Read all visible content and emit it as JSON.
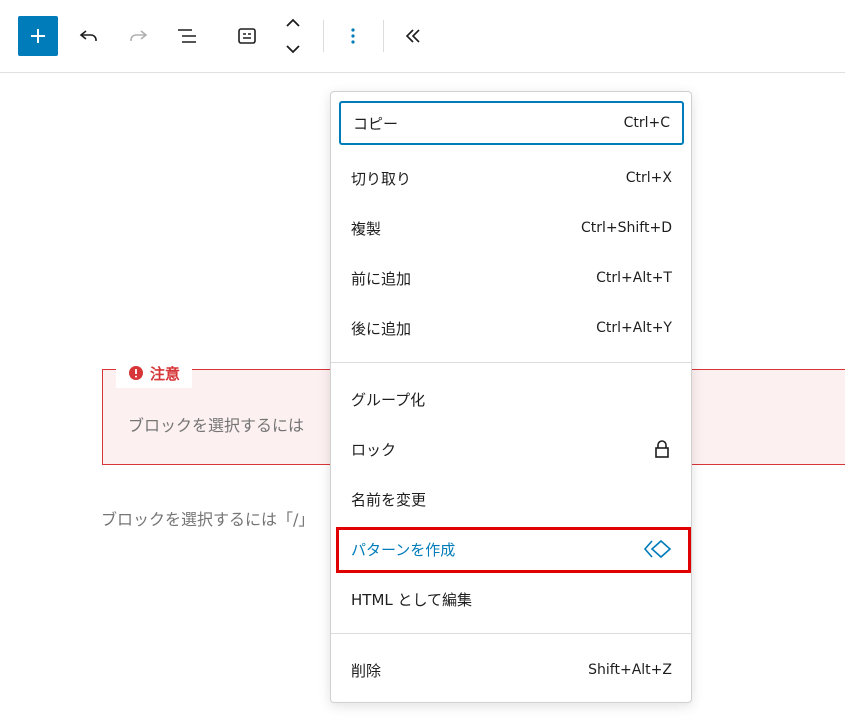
{
  "toolbar": {
    "add_icon": "plus-icon",
    "undo_icon": "undo-icon",
    "redo_icon": "redo-icon",
    "list_view_icon": "list-view-icon",
    "block_icon": "block-type-icon",
    "move_icon": "move-up-down-icon",
    "options_icon": "more-vertical-icon",
    "collapse_icon": "collapse-icon",
    "accent_color": "#007cba"
  },
  "notice": {
    "label": "注意",
    "text": "ブロックを選択するには",
    "color": "#d63638"
  },
  "paragraph": {
    "text": "ブロックを選択するには「/」"
  },
  "menu": {
    "groups": [
      [
        {
          "label": "コピー",
          "shortcut": "Ctrl+C"
        },
        {
          "label": "切り取り",
          "shortcut": "Ctrl+X"
        },
        {
          "label": "複製",
          "shortcut": "Ctrl+Shift+D"
        },
        {
          "label": "前に追加",
          "shortcut": "Ctrl+Alt+T"
        },
        {
          "label": "後に追加",
          "shortcut": "Ctrl+Alt+Y"
        }
      ],
      [
        {
          "label": "グループ化"
        },
        {
          "label": "ロック",
          "icon": "lock-icon"
        },
        {
          "label": "名前を変更"
        },
        {
          "label": "パターンを作成",
          "icon": "pattern-icon"
        },
        {
          "label": "HTML として編集"
        }
      ],
      [
        {
          "label": "削除",
          "shortcut": "Shift+Alt+Z"
        }
      ]
    ]
  }
}
